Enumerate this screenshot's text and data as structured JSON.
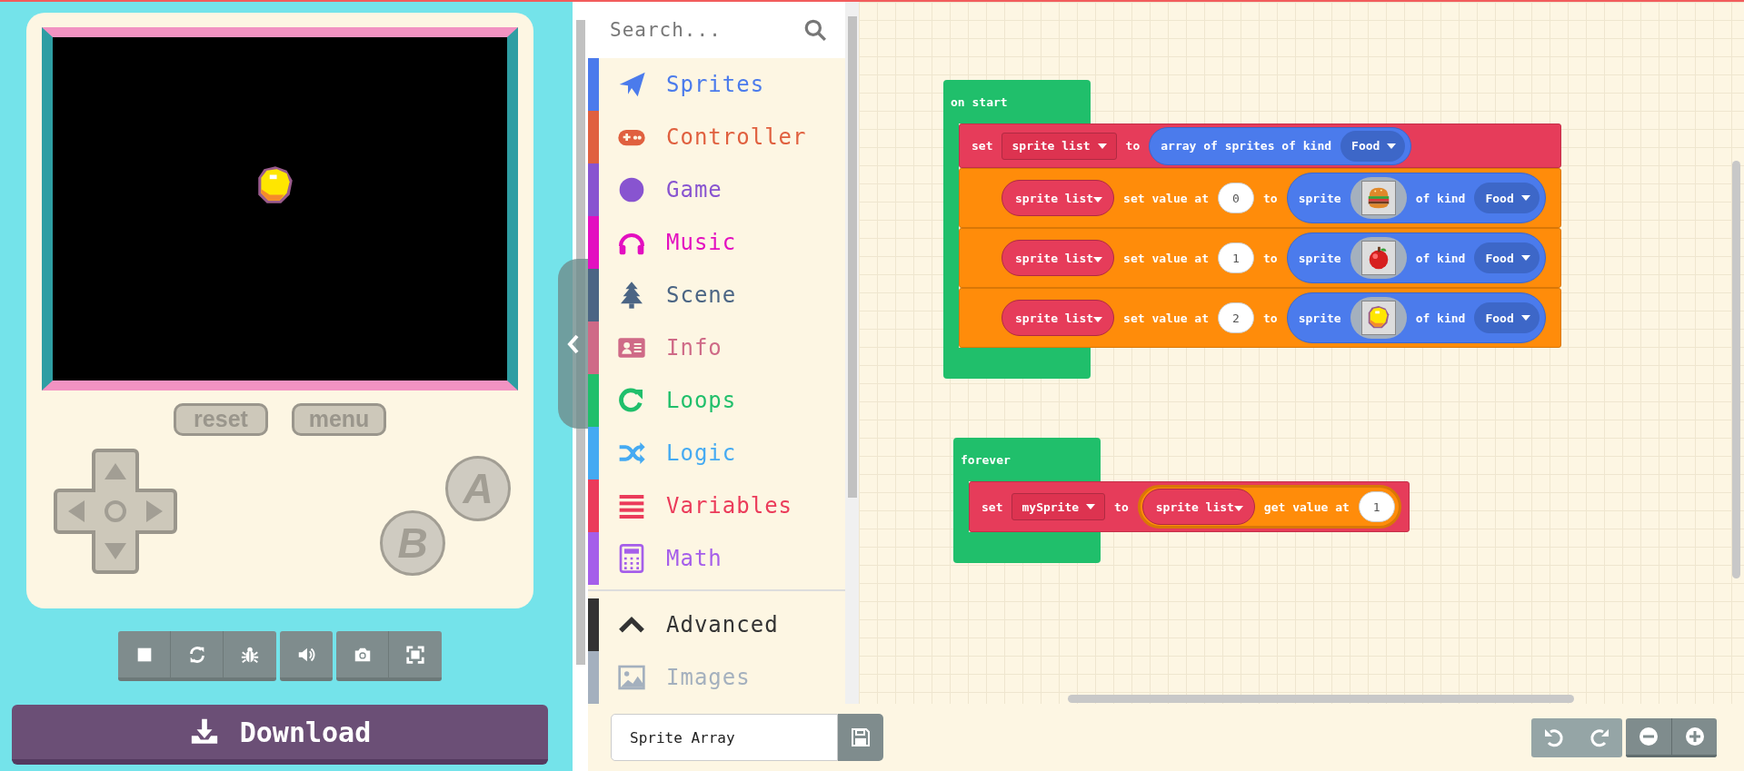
{
  "simulator": {
    "buttons": [
      {
        "label": "reset"
      },
      {
        "label": "menu"
      }
    ],
    "face_buttons": [
      {
        "label": "A"
      },
      {
        "label": "B"
      }
    ]
  },
  "download": {
    "label": "Download"
  },
  "toolbox": {
    "search": {
      "placeholder": "Search..."
    },
    "categories": [
      {
        "label": "Sprites",
        "color": "#4b7bec"
      },
      {
        "label": "Controller",
        "color": "#e0603f"
      },
      {
        "label": "Game",
        "color": "#8854d0"
      },
      {
        "label": "Music",
        "color": "#e30fc0"
      },
      {
        "label": "Scene",
        "color": "#4b6584"
      },
      {
        "label": "Info",
        "color": "#cf6a87"
      },
      {
        "label": "Loops",
        "color": "#20bf6b"
      },
      {
        "label": "Logic",
        "color": "#45aaf2"
      },
      {
        "label": "Variables",
        "color": "#eb3b5a"
      },
      {
        "label": "Math",
        "color": "#a55eea"
      }
    ],
    "advanced": [
      {
        "label": "Advanced",
        "color": "#333333"
      },
      {
        "label": "Images",
        "color": "#a4b0be"
      }
    ]
  },
  "workspace": {
    "blocks": [
      {
        "kind": "event",
        "label": "on start",
        "statements": [
          {
            "kind": "set",
            "keyword": "set",
            "variable": "sprite list",
            "to": "to",
            "value": {
              "kind": "array_of_kind",
              "label": "array of sprites of kind",
              "kind_name": "Food"
            }
          },
          {
            "kind": "list_set",
            "list": "sprite list",
            "label": "set value at",
            "index": "0",
            "to": "to",
            "value": {
              "kind": "sprite_of_kind",
              "label": "sprite",
              "of_kind": "of kind",
              "kind_name": "Food"
            }
          },
          {
            "kind": "list_set",
            "list": "sprite list",
            "label": "set value at",
            "index": "1",
            "to": "to",
            "value": {
              "kind": "sprite_of_kind",
              "label": "sprite",
              "of_kind": "of kind",
              "kind_name": "Food"
            }
          },
          {
            "kind": "list_set",
            "list": "sprite list",
            "label": "set value at",
            "index": "2",
            "to": "to",
            "value": {
              "kind": "sprite_of_kind",
              "label": "sprite",
              "of_kind": "of kind",
              "kind_name": "Food"
            }
          }
        ]
      },
      {
        "kind": "event",
        "label": "forever",
        "statements": [
          {
            "kind": "set",
            "keyword": "set",
            "variable": "mySprite",
            "to": "to",
            "value": {
              "kind": "list_get",
              "list": "sprite list",
              "label": "get value at",
              "index": "1"
            }
          }
        ]
      }
    ]
  },
  "project": {
    "name": "Sprite Array"
  }
}
